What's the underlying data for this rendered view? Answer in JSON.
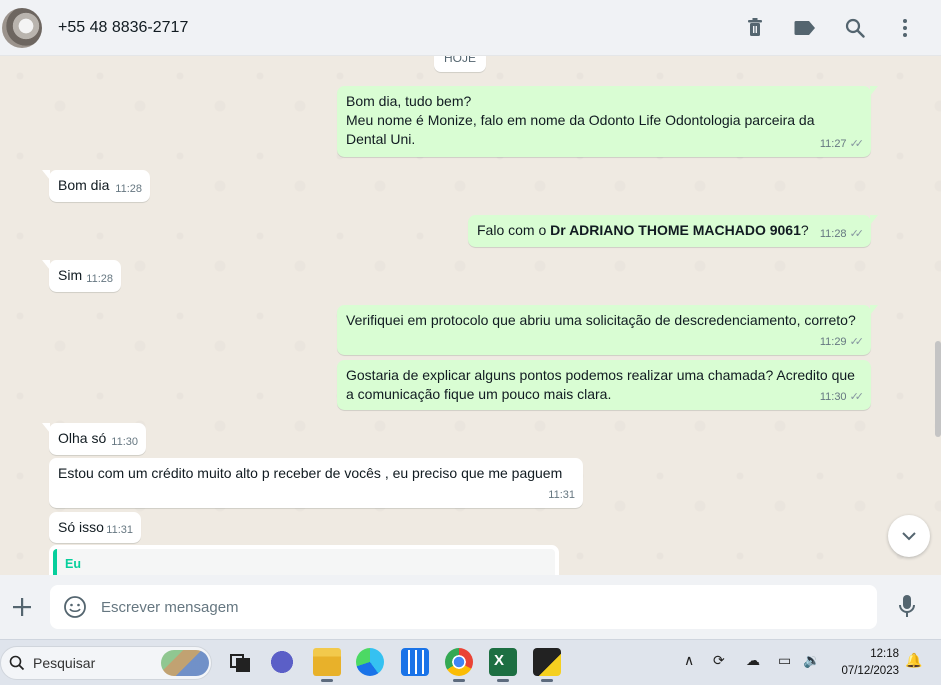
{
  "header": {
    "contact": "+55 48 8836-2717",
    "actions": [
      "delete-icon",
      "label-icon",
      "search-icon",
      "menu-icon"
    ]
  },
  "chat": {
    "date_chip": "HOJE",
    "messages": [
      {
        "dir": "out",
        "lines": [
          "Bom dia, tudo bem?",
          "Meu nome é Monize, falo em nome da Odonto Life Odontologia parceira da",
          "Dental Uni."
        ],
        "time": "11:27"
      },
      {
        "dir": "in",
        "text": "Bom dia",
        "time": "11:28"
      },
      {
        "dir": "out",
        "prefix": "Falo com o ",
        "bold": "Dr ADRIANO THOME MACHADO 9061",
        "suffix": "?",
        "time": "11:28"
      },
      {
        "dir": "in",
        "text": "Sim",
        "time": "11:28"
      },
      {
        "dir": "out",
        "text": "Verifiquei em protocolo que abriu uma solicitação de descredenciamento, correto?",
        "time": "11:29"
      },
      {
        "dir": "out",
        "lines": [
          "Gostaria de explicar alguns pontos podemos realizar uma chamada? Acredito que",
          "a comunicação fique um pouco mais clara."
        ],
        "time": "11:30"
      },
      {
        "dir": "in",
        "text": "Olha só",
        "time": "11:30"
      },
      {
        "dir": "in",
        "text": "Estou com um crédito muito alto p receber de vocês , eu preciso que me paguem",
        "time": "11:31"
      },
      {
        "dir": "in",
        "text": "Só isso",
        "time": "11:31"
      }
    ],
    "quote_author": "Eu",
    "ticks": "✓✓"
  },
  "compose": {
    "placeholder": "Escrever mensagem"
  },
  "taskbar": {
    "search_label": "Pesquisar",
    "time": "12:18",
    "date": "07/12/2023",
    "colors": {
      "whatsapp_green": "#d9fdd3",
      "accent": "#06cf9c"
    }
  }
}
